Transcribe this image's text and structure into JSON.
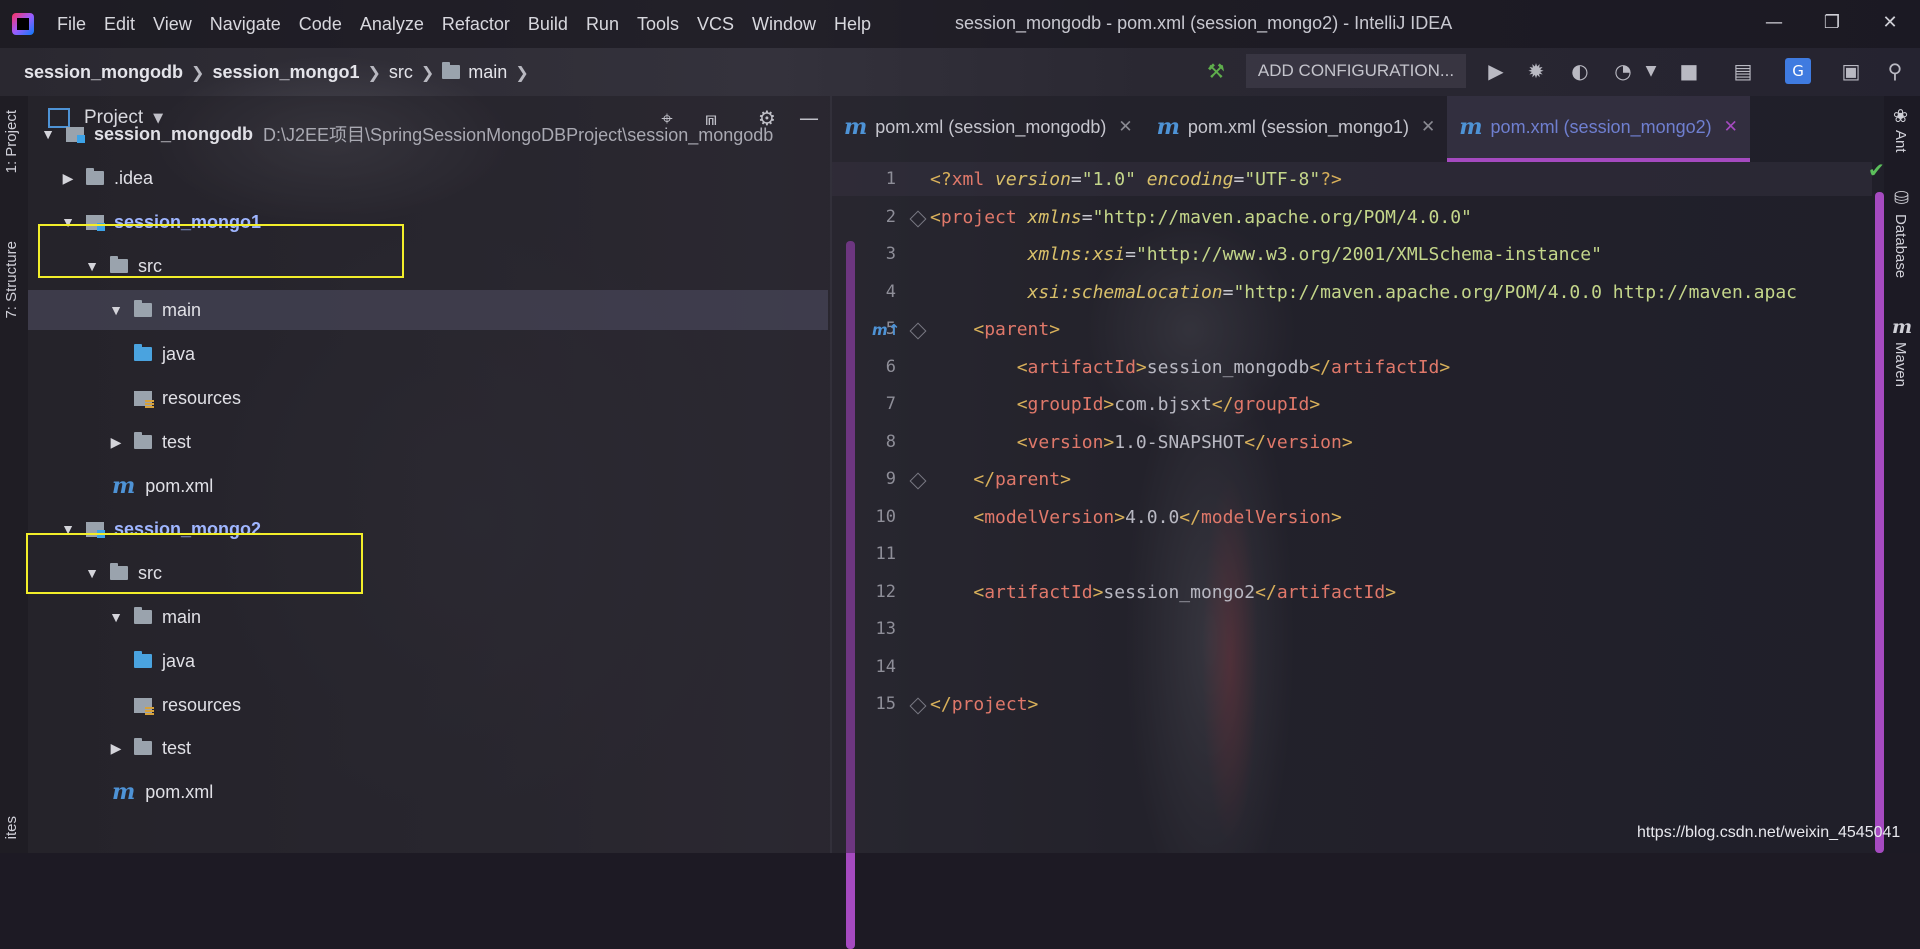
{
  "app": {
    "title": "session_mongodb - pom.xml (session_mongo2) - IntelliJ IDEA",
    "menu": [
      "File",
      "Edit",
      "View",
      "Navigate",
      "Code",
      "Analyze",
      "Refactor",
      "Build",
      "Run",
      "Tools",
      "VCS",
      "Window",
      "Help"
    ]
  },
  "breadcrumb": [
    "session_mongodb",
    "session_mongo1",
    "src",
    "main"
  ],
  "toolbar": {
    "run_config": "ADD CONFIGURATION..."
  },
  "left_tabs": [
    "1: Project",
    "7: Structure",
    "ites"
  ],
  "right_tabs": [
    "Ant",
    "Database",
    "Maven"
  ],
  "project": {
    "title": "Project",
    "tree": [
      {
        "label": "session_mongodb",
        "path": "D:\\J2EE项目\\SpringSessionMongoDBProject\\session_mongodb",
        "icon": "module-icon",
        "expanded": true
      },
      {
        "label": ".idea",
        "icon": "folder-icon",
        "expanded": false
      },
      {
        "label": "session_mongo1",
        "icon": "module-icon",
        "expanded": true
      },
      {
        "label": "src",
        "icon": "folder-icon",
        "expanded": true
      },
      {
        "label": "main",
        "icon": "folder-icon",
        "expanded": true,
        "selected": true
      },
      {
        "label": "java",
        "icon": "source-folder-icon"
      },
      {
        "label": "resources",
        "icon": "resources-folder-icon"
      },
      {
        "label": "test",
        "icon": "folder-icon",
        "expanded": false
      },
      {
        "label": "pom.xml",
        "icon": "maven-icon"
      },
      {
        "label": "session_mongo2",
        "icon": "module-icon",
        "expanded": true
      },
      {
        "label": "src",
        "icon": "folder-icon",
        "expanded": true
      },
      {
        "label": "main",
        "icon": "folder-icon",
        "expanded": true
      },
      {
        "label": "java",
        "icon": "source-folder-icon"
      },
      {
        "label": "resources",
        "icon": "resources-folder-icon"
      },
      {
        "label": "test",
        "icon": "folder-icon",
        "expanded": false
      },
      {
        "label": "pom.xml",
        "icon": "maven-icon"
      }
    ]
  },
  "editor": {
    "tabs": [
      {
        "label": "pom.xml (session_mongodb)",
        "active": false
      },
      {
        "label": "pom.xml (session_mongo1)",
        "active": false
      },
      {
        "label": "pom.xml (session_mongo2)",
        "active": true
      }
    ],
    "line_numbers": [
      "1",
      "2",
      "3",
      "4",
      "5",
      "6",
      "7",
      "8",
      "9",
      "10",
      "11",
      "12",
      "13",
      "14",
      "15"
    ],
    "lines": [
      "<?xml version=\"1.0\" encoding=\"UTF-8\"?>",
      "<project xmlns=\"http://maven.apache.org/POM/4.0.0\"",
      "         xmlns:xsi=\"http://www.w3.org/2001/XMLSchema-instance\"",
      "         xsi:schemaLocation=\"http://maven.apache.org/POM/4.0.0 http://maven.apac",
      "    <parent>",
      "        <artifactId>session_mongodb</artifactId>",
      "        <groupId>com.bjsxt</groupId>",
      "        <version>1.0-SNAPSHOT</version>",
      "    </parent>",
      "    <modelVersion>4.0.0</modelVersion>",
      "",
      "    <artifactId>session_mongo2</artifactId>",
      "",
      "",
      "</project>"
    ]
  },
  "watermark": "https://blog.csdn.net/weixin_4545041",
  "colors": {
    "accent": "#a54ac0",
    "highlight_box": "#f2ee2a",
    "maven_icon": "#4e93d6"
  }
}
